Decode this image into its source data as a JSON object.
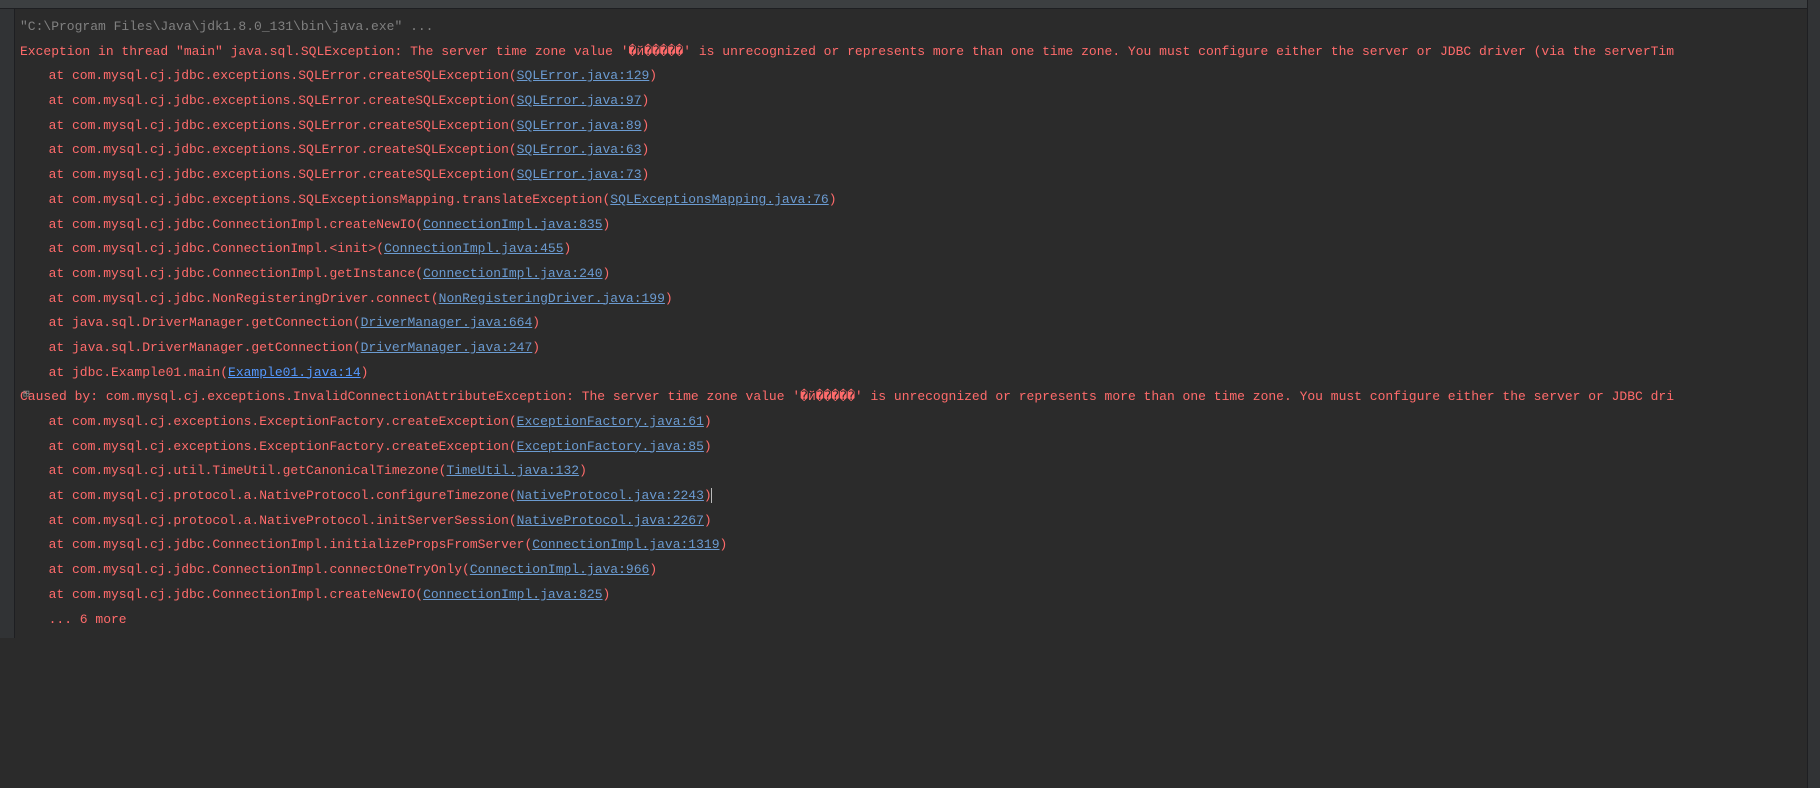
{
  "command": "\"C:\\Program Files\\Java\\jdk1.8.0_131\\bin\\java.exe\" ...",
  "exceptionLine": "Exception in thread \"main\" java.sql.SQLException: The server time zone value '�й���׼��' is unrecognized or represents more than one time zone. You must configure either the server or JDBC driver (via the serverTim",
  "stack1": [
    {
      "prefix": "at com.mysql.cj.jdbc.exceptions.SQLError.createSQLException(",
      "link": "SQLError.java:129",
      "suffix": ")"
    },
    {
      "prefix": "at com.mysql.cj.jdbc.exceptions.SQLError.createSQLException(",
      "link": "SQLError.java:97",
      "suffix": ")"
    },
    {
      "prefix": "at com.mysql.cj.jdbc.exceptions.SQLError.createSQLException(",
      "link": "SQLError.java:89",
      "suffix": ")"
    },
    {
      "prefix": "at com.mysql.cj.jdbc.exceptions.SQLError.createSQLException(",
      "link": "SQLError.java:63",
      "suffix": ")"
    },
    {
      "prefix": "at com.mysql.cj.jdbc.exceptions.SQLError.createSQLException(",
      "link": "SQLError.java:73",
      "suffix": ")"
    },
    {
      "prefix": "at com.mysql.cj.jdbc.exceptions.SQLExceptionsMapping.translateException(",
      "link": "SQLExceptionsMapping.java:76",
      "suffix": ")"
    },
    {
      "prefix": "at com.mysql.cj.jdbc.ConnectionImpl.createNewIO(",
      "link": "ConnectionImpl.java:835",
      "suffix": ")"
    },
    {
      "prefix": "at com.mysql.cj.jdbc.ConnectionImpl.<init>(",
      "link": "ConnectionImpl.java:455",
      "suffix": ")"
    },
    {
      "prefix": "at com.mysql.cj.jdbc.ConnectionImpl.getInstance(",
      "link": "ConnectionImpl.java:240",
      "suffix": ")"
    },
    {
      "prefix": "at com.mysql.cj.jdbc.NonRegisteringDriver.connect(",
      "link": "NonRegisteringDriver.java:199",
      "suffix": ")"
    },
    {
      "prefix": "at java.sql.DriverManager.getConnection(",
      "link": "DriverManager.java:664",
      "suffix": ")"
    },
    {
      "prefix": "at java.sql.DriverManager.getConnection(",
      "link": "DriverManager.java:247",
      "suffix": ")"
    },
    {
      "prefix": "at jdbc.Example01.main(",
      "link": "Example01.java:14",
      "suffix": ")",
      "own": true
    }
  ],
  "causedByLine": "Caused by: com.mysql.cj.exceptions.InvalidConnectionAttributeException: The server time zone value '�й���׼��' is unrecognized or represents more than one time zone. You must configure either the server or JDBC dri",
  "stack2": [
    {
      "prefix": "at com.mysql.cj.exceptions.ExceptionFactory.createException(",
      "link": "ExceptionFactory.java:61",
      "suffix": ")"
    },
    {
      "prefix": "at com.mysql.cj.exceptions.ExceptionFactory.createException(",
      "link": "ExceptionFactory.java:85",
      "suffix": ")"
    },
    {
      "prefix": "at com.mysql.cj.util.TimeUtil.getCanonicalTimezone(",
      "link": "TimeUtil.java:132",
      "suffix": ")"
    },
    {
      "prefix": "at com.mysql.cj.protocol.a.NativeProtocol.configureTimezone(",
      "link": "NativeProtocol.java:2243",
      "suffix": ")",
      "cursor": true
    },
    {
      "prefix": "at com.mysql.cj.protocol.a.NativeProtocol.initServerSession(",
      "link": "NativeProtocol.java:2267",
      "suffix": ")"
    },
    {
      "prefix": "at com.mysql.cj.jdbc.ConnectionImpl.initializePropsFromServer(",
      "link": "ConnectionImpl.java:1319",
      "suffix": ")"
    },
    {
      "prefix": "at com.mysql.cj.jdbc.ConnectionImpl.connectOneTryOnly(",
      "link": "ConnectionImpl.java:966",
      "suffix": ")"
    },
    {
      "prefix": "at com.mysql.cj.jdbc.ConnectionImpl.createNewIO(",
      "link": "ConnectionImpl.java:825",
      "suffix": ")"
    }
  ],
  "moreLine": "... 6 more",
  "expandGlyph": "⊞"
}
